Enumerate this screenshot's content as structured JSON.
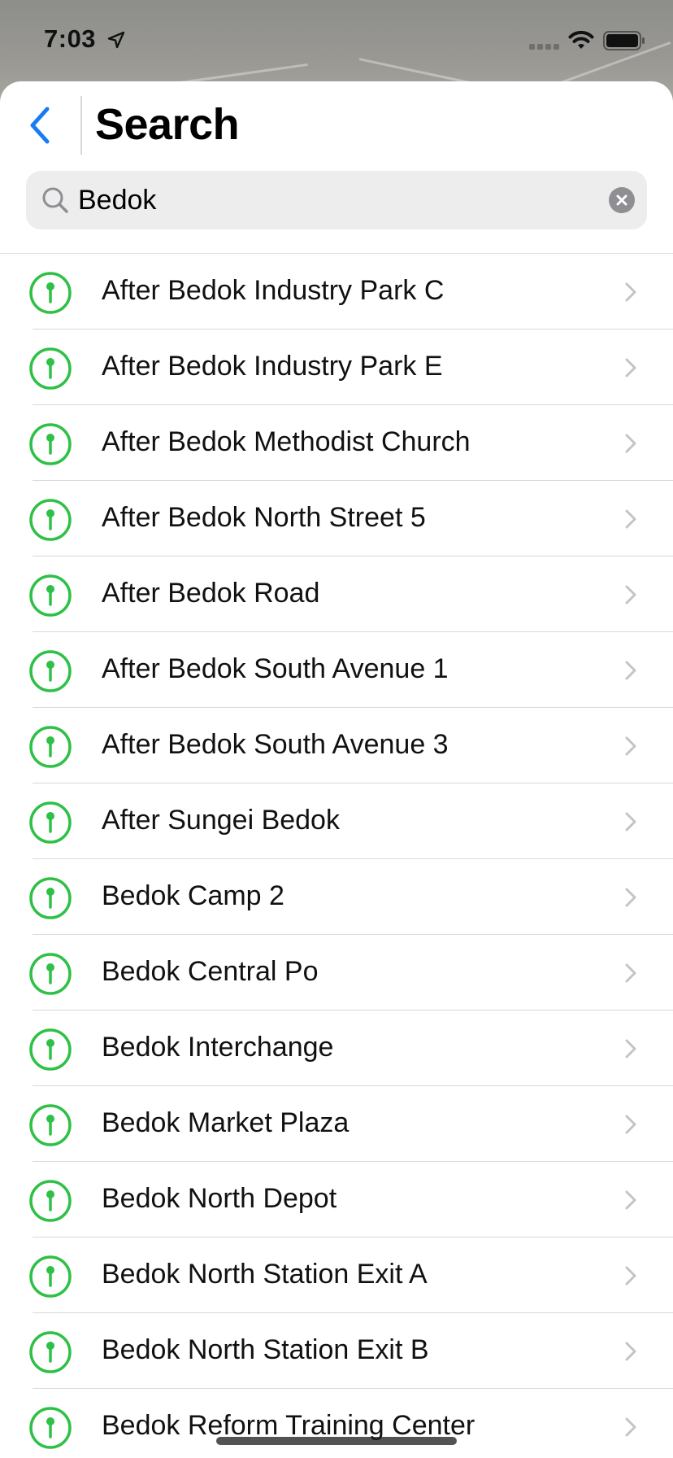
{
  "colors": {
    "accent": "#1a7cf5",
    "pin_green": "#2fc046",
    "chevron_gray": "#c4c4c8"
  },
  "status_bar": {
    "time": "7:03"
  },
  "header": {
    "title": "Search",
    "back_icon": "chevron-left-icon"
  },
  "search": {
    "value": "Bedok",
    "placeholder": "Search"
  },
  "results": [
    {
      "label": "After Bedok Industry Park C"
    },
    {
      "label": "After Bedok Industry Park E"
    },
    {
      "label": "After Bedok Methodist Church"
    },
    {
      "label": "After Bedok North Street 5"
    },
    {
      "label": "After Bedok Road"
    },
    {
      "label": "After Bedok South Avenue 1"
    },
    {
      "label": "After Bedok South Avenue 3"
    },
    {
      "label": "After Sungei Bedok"
    },
    {
      "label": "Bedok Camp 2"
    },
    {
      "label": "Bedok Central Po"
    },
    {
      "label": "Bedok Interchange"
    },
    {
      "label": "Bedok Market Plaza"
    },
    {
      "label": "Bedok North Depot"
    },
    {
      "label": "Bedok North Station Exit A"
    },
    {
      "label": "Bedok North Station Exit B"
    },
    {
      "label": "Bedok Reform Training Center"
    }
  ]
}
